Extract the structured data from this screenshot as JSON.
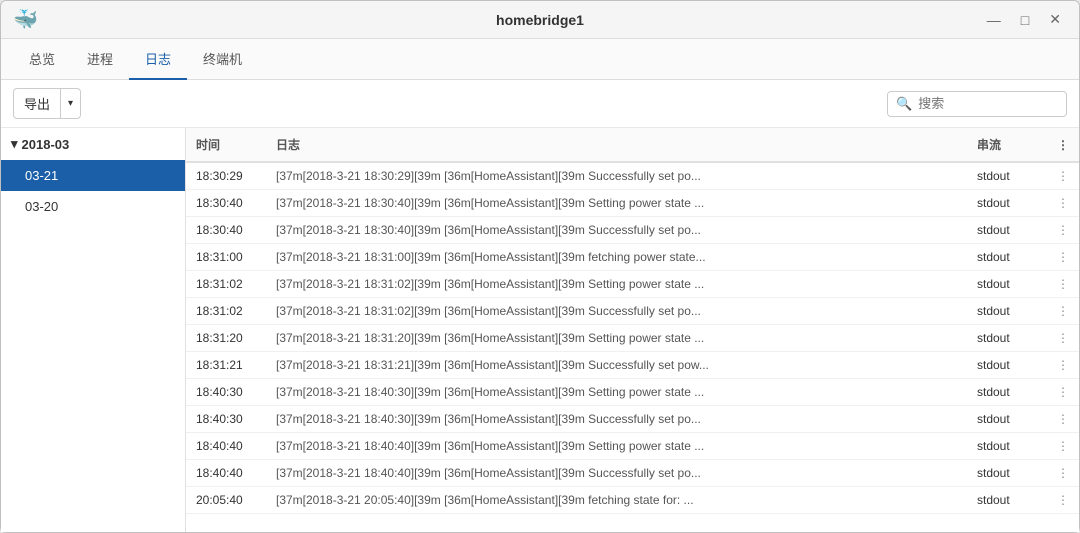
{
  "window": {
    "title": "homebridge1",
    "icon": "🐳"
  },
  "titlebar": {
    "minimize": "—",
    "maximize": "□",
    "close": "✕"
  },
  "tabs": [
    {
      "label": "总览",
      "active": false
    },
    {
      "label": "进程",
      "active": false
    },
    {
      "label": "日志",
      "active": true
    },
    {
      "label": "终端机",
      "active": false
    }
  ],
  "toolbar": {
    "export_label": "导出",
    "search_placeholder": "搜索"
  },
  "sidebar": {
    "group": "2018-03",
    "items": [
      {
        "label": "03-21",
        "active": true
      },
      {
        "label": "03-20",
        "active": false
      }
    ]
  },
  "table": {
    "columns": [
      "时间",
      "日志",
      "串流",
      ""
    ],
    "rows": [
      {
        "time": "18:30:29",
        "log": "[37m[2018-3-21 18:30:29][39m [36m[HomeAssistant][39m Successfully set po...",
        "stream": "stdout"
      },
      {
        "time": "18:30:40",
        "log": "[37m[2018-3-21 18:30:40][39m [36m[HomeAssistant][39m Setting power state ...",
        "stream": "stdout"
      },
      {
        "time": "18:30:40",
        "log": "[37m[2018-3-21 18:30:40][39m [36m[HomeAssistant][39m Successfully set po...",
        "stream": "stdout"
      },
      {
        "time": "18:31:00",
        "log": "[37m[2018-3-21 18:31:00][39m [36m[HomeAssistant][39m fetching power state...",
        "stream": "stdout"
      },
      {
        "time": "18:31:02",
        "log": "[37m[2018-3-21 18:31:02][39m [36m[HomeAssistant][39m Setting power state ...",
        "stream": "stdout"
      },
      {
        "time": "18:31:02",
        "log": "[37m[2018-3-21 18:31:02][39m [36m[HomeAssistant][39m Successfully set po...",
        "stream": "stdout"
      },
      {
        "time": "18:31:20",
        "log": "[37m[2018-3-21 18:31:20][39m [36m[HomeAssistant][39m Setting power state ...",
        "stream": "stdout"
      },
      {
        "time": "18:31:21",
        "log": "[37m[2018-3-21 18:31:21][39m [36m[HomeAssistant][39m Successfully set pow...",
        "stream": "stdout"
      },
      {
        "time": "18:40:30",
        "log": "[37m[2018-3-21 18:40:30][39m [36m[HomeAssistant][39m Setting power state ...",
        "stream": "stdout"
      },
      {
        "time": "18:40:30",
        "log": "[37m[2018-3-21 18:40:30][39m [36m[HomeAssistant][39m Successfully set po...",
        "stream": "stdout"
      },
      {
        "time": "18:40:40",
        "log": "[37m[2018-3-21 18:40:40][39m [36m[HomeAssistant][39m Setting power state ...",
        "stream": "stdout"
      },
      {
        "time": "18:40:40",
        "log": "[37m[2018-3-21 18:40:40][39m [36m[HomeAssistant][39m Successfully set po...",
        "stream": "stdout"
      },
      {
        "time": "20:05:40",
        "log": "[37m[2018-3-21 20:05:40][39m [36m[HomeAssistant][39m fetching state for: ...",
        "stream": "stdout"
      }
    ]
  }
}
